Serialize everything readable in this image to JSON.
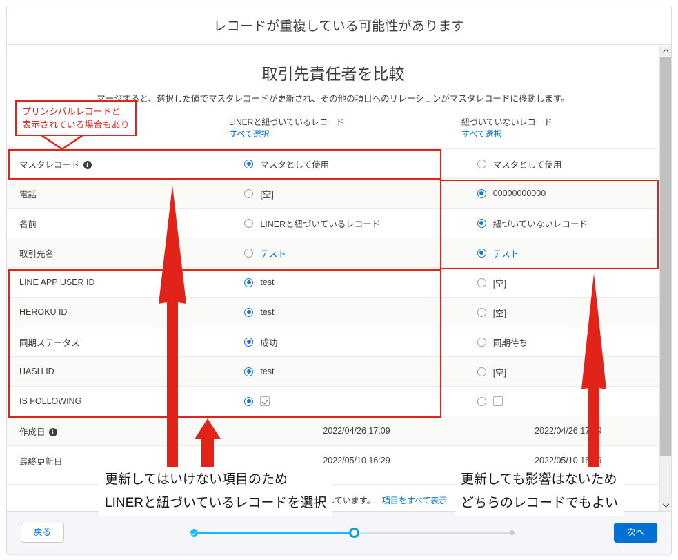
{
  "dialog": {
    "title": "レコードが重複している可能性があります",
    "compare_title": "取引先責任者を比較",
    "compare_subtitle": "マージすると、選択した値でマスタレコードが更新され、その他の項目へのリレーションがマスタレコードに移動します。"
  },
  "columns": [
    {
      "label": "LINERと紐づいているレコード",
      "select_all": "すべて選択"
    },
    {
      "label": "紐づいていないレコード",
      "select_all": "すべて選択"
    }
  ],
  "rows": [
    {
      "label": "マスタレコード",
      "has_info": true,
      "a": {
        "value": "マスタとして使用",
        "selected": true,
        "style": "text"
      },
      "b": {
        "value": "マスタとして使用",
        "selected": false,
        "style": "text"
      }
    },
    {
      "label": "電話",
      "has_info": false,
      "a": {
        "value": "[空]",
        "selected": false,
        "style": "text"
      },
      "b": {
        "value": "00000000000",
        "selected": true,
        "style": "text"
      }
    },
    {
      "label": "名前",
      "has_info": false,
      "a": {
        "value": "LINERと紐づいているレコード",
        "selected": false,
        "style": "text"
      },
      "b": {
        "value": "紐づいていないレコード",
        "selected": true,
        "style": "text"
      }
    },
    {
      "label": "取引先名",
      "has_info": false,
      "a": {
        "value": "テスト",
        "selected": false,
        "style": "link"
      },
      "b": {
        "value": "テスト",
        "selected": true,
        "style": "link"
      }
    },
    {
      "label": "LINE APP USER ID",
      "has_info": false,
      "a": {
        "value": "test",
        "selected": true,
        "style": "text"
      },
      "b": {
        "value": "[空]",
        "selected": false,
        "style": "text"
      }
    },
    {
      "label": "HEROKU ID",
      "has_info": false,
      "a": {
        "value": "test",
        "selected": true,
        "style": "text"
      },
      "b": {
        "value": "[空]",
        "selected": false,
        "style": "text"
      }
    },
    {
      "label": "同期ステータス",
      "has_info": false,
      "a": {
        "value": "成功",
        "selected": true,
        "style": "text"
      },
      "b": {
        "value": "同期待ち",
        "selected": false,
        "style": "text"
      }
    },
    {
      "label": "HASH ID",
      "has_info": false,
      "a": {
        "value": "test",
        "selected": true,
        "style": "text"
      },
      "b": {
        "value": "[空]",
        "selected": false,
        "style": "text"
      }
    },
    {
      "label": "IS FOLLOWING",
      "has_info": false,
      "a": {
        "value": "",
        "selected": true,
        "style": "checkbox",
        "checked": true
      },
      "b": {
        "value": "",
        "selected": false,
        "style": "checkbox",
        "checked": false
      }
    },
    {
      "label": "作成日",
      "has_info": true,
      "a": {
        "value": "2022/04/26 17:09",
        "selected": null,
        "style": "date"
      },
      "b": {
        "value": "2022/04/26 17:09",
        "selected": null,
        "style": "date"
      }
    },
    {
      "label": "最終更新日",
      "has_info": false,
      "a": {
        "value": "2022/05/10 16:29",
        "selected": null,
        "style": "date"
      },
      "b": {
        "value": "2022/05/10 16:29",
        "selected": null,
        "style": "date"
      }
    }
  ],
  "footer_note": {
    "text": "表示されていない項目は一致しています。",
    "link": "項目をすべて表示"
  },
  "footer": {
    "back_label": "戻る",
    "next_label": "次へ"
  },
  "stepper": {
    "steps": [
      {
        "state": "complete"
      },
      {
        "state": "current"
      },
      {
        "state": "pending"
      }
    ]
  },
  "annotations": {
    "callout_principal": "プリンシパルレコードと\n表示されている場合もあり",
    "callout_principal_line1": "プリンシパルレコードと",
    "callout_principal_line2": "表示されている場合もあり",
    "note_left_line1": "更新してはいけない項目のため",
    "note_left_line2": "LINERと紐づいているレコードを選択",
    "note_right_line1": "更新しても影響はないため",
    "note_right_line2": "どちらのレコードでもよい",
    "accent_color": "#e2231a"
  }
}
